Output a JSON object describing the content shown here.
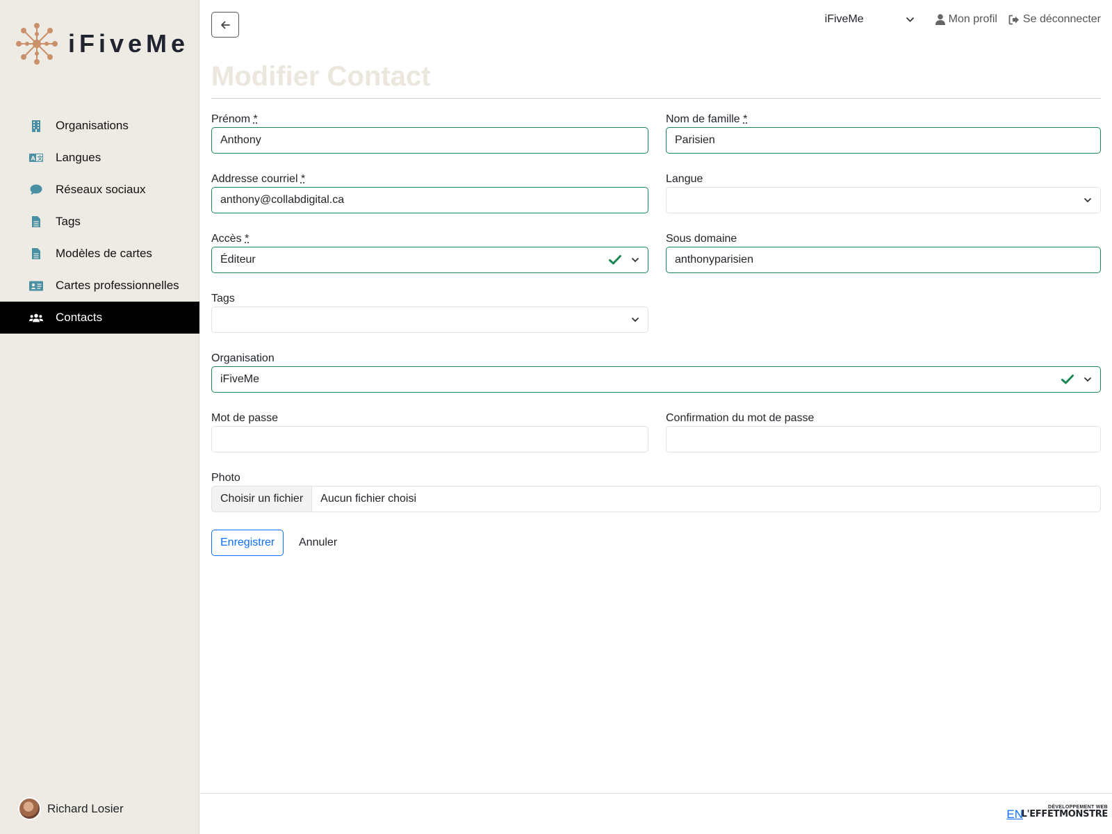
{
  "brand": {
    "name": "iFiveMe",
    "accent": "#c9906a"
  },
  "sidebar": {
    "items": [
      {
        "label": "Organisations",
        "icon": "building-icon"
      },
      {
        "label": "Langues",
        "icon": "translate-icon"
      },
      {
        "label": "Réseaux sociaux",
        "icon": "chat-bubble-icon"
      },
      {
        "label": "Tags",
        "icon": "document-icon"
      },
      {
        "label": "Modèles de cartes",
        "icon": "document-icon"
      },
      {
        "label": "Cartes professionnelles",
        "icon": "id-card-icon"
      },
      {
        "label": "Contacts",
        "icon": "users-icon",
        "active": true
      }
    ],
    "user_name": "Richard Losier"
  },
  "header": {
    "organization": "iFiveMe",
    "profile_label": "Mon profil",
    "logout_label": "Se déconnecter"
  },
  "page": {
    "title": "Modifier Contact"
  },
  "form": {
    "first_name": {
      "label": "Prénom",
      "value": "Anthony"
    },
    "last_name": {
      "label": "Nom de famille",
      "value": "Parisien"
    },
    "email": {
      "label": "Addresse courriel",
      "value": "anthony@collabdigital.ca"
    },
    "language": {
      "label": "Langue",
      "value": ""
    },
    "access": {
      "label": "Accès",
      "value": "Éditeur"
    },
    "subdomain": {
      "label": "Sous domaine",
      "value": "anthonyparisien"
    },
    "tags": {
      "label": "Tags",
      "value": ""
    },
    "organization": {
      "label": "Organisation",
      "value": "iFiveMe"
    },
    "password": {
      "label": "Mot de passe",
      "value": ""
    },
    "password_confirm": {
      "label": "Confirmation du mot de passe",
      "value": ""
    },
    "photo": {
      "label": "Photo",
      "button": "Choisir un fichier",
      "status": "Aucun fichier choisi"
    },
    "required_mark": "*",
    "save_label": "Enregistrer",
    "cancel_label": "Annuler"
  },
  "footer": {
    "lang_switch": "EN",
    "credit_small": "DÉVELOPPEMENT WEB",
    "credit_big": "L'EFFETMONSTRE"
  },
  "colors": {
    "valid": "#198754",
    "primary": "#0d6efd",
    "sidebar_bg": "#eeebe4",
    "icon": "#4a90a4"
  }
}
